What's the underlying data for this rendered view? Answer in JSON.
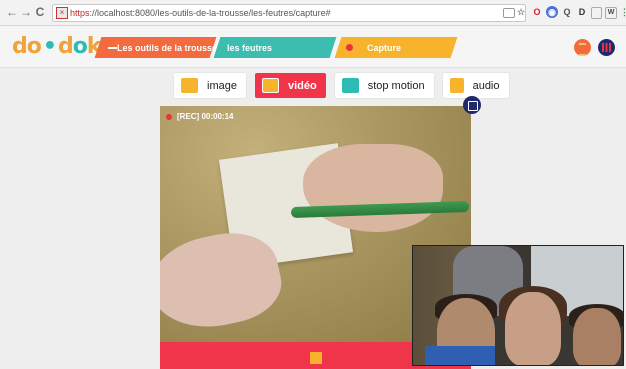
{
  "browser": {
    "back_icon": "arrow-left-icon",
    "forward_icon": "arrow-right-icon",
    "reload_icon": "reload-icon",
    "url_scheme": "https",
    "url_rest": "://localhost:8080/les-outils-de-la-trousse/les-feutres/capture#"
  },
  "header": {
    "logo": "do•dok",
    "breadcrumb": {
      "tool_category": "Les outils de la trousse",
      "tool": "les feutres",
      "current": "Capture"
    }
  },
  "modes": [
    {
      "label": "image",
      "icon": "image-icon",
      "active": false
    },
    {
      "label": "vidéo",
      "icon": "video-icon",
      "active": true
    },
    {
      "label": "stop motion",
      "icon": "stop-motion-icon",
      "active": false
    },
    {
      "label": "audio",
      "icon": "audio-icon",
      "active": false
    }
  ],
  "video": {
    "rec_label": "[REC] 00:00:14"
  },
  "colors": {
    "accent_red": "#f0354a",
    "orange": "#f26a3d",
    "teal": "#3dbcb0",
    "yellow": "#f7b32b",
    "navy": "#1f2a6e"
  }
}
